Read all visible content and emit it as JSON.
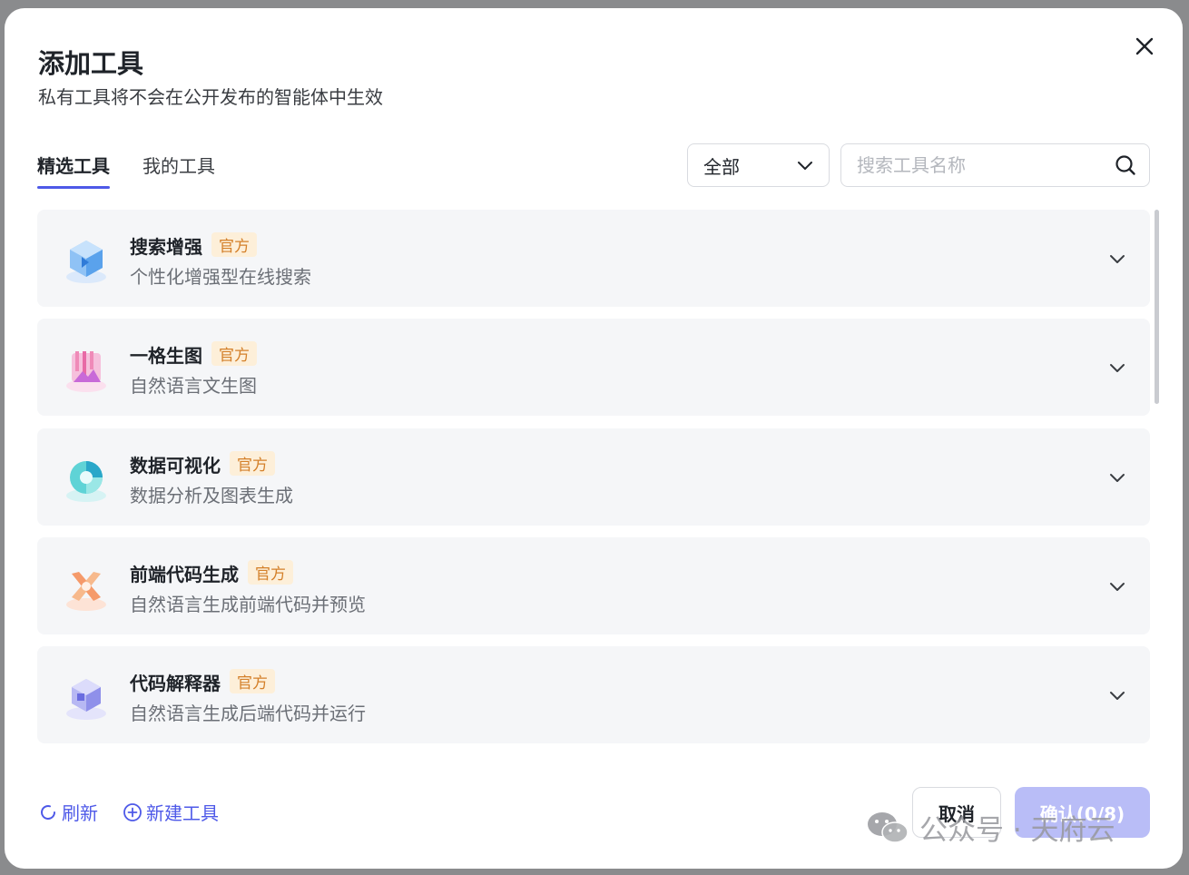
{
  "modal": {
    "title": "添加工具",
    "subtitle": "私有工具将不会在公开发布的智能体中生效"
  },
  "tabs": [
    {
      "label": "精选工具",
      "active": true
    },
    {
      "label": "我的工具",
      "active": false
    }
  ],
  "filter": {
    "selected": "全部"
  },
  "search": {
    "placeholder": "搜索工具名称",
    "value": ""
  },
  "tools": [
    {
      "name": "搜索增强",
      "badge": "官方",
      "desc": "个性化增强型在线搜索",
      "icon": "cube-search-icon"
    },
    {
      "name": "一格生图",
      "badge": "官方",
      "desc": "自然语言文生图",
      "icon": "image-gen-icon"
    },
    {
      "name": "数据可视化",
      "badge": "官方",
      "desc": "数据分析及图表生成",
      "icon": "chart-ring-icon"
    },
    {
      "name": "前端代码生成",
      "badge": "官方",
      "desc": "自然语言生成前端代码并预览",
      "icon": "code-x-icon"
    },
    {
      "name": "代码解释器",
      "badge": "官方",
      "desc": "自然语言生成后端代码并运行",
      "icon": "code-cube-icon"
    }
  ],
  "footer": {
    "refresh": "刷新",
    "new_tool": "新建工具",
    "cancel": "取消",
    "confirm": "确认(0/8)"
  },
  "watermark": "公众号 · 天府云",
  "colors": {
    "accent": "#4e59e8",
    "badge_bg": "#fdefd9",
    "badge_text": "#d4802a",
    "card_bg": "#f5f6f8",
    "confirm_disabled": "#b9bdf7"
  }
}
